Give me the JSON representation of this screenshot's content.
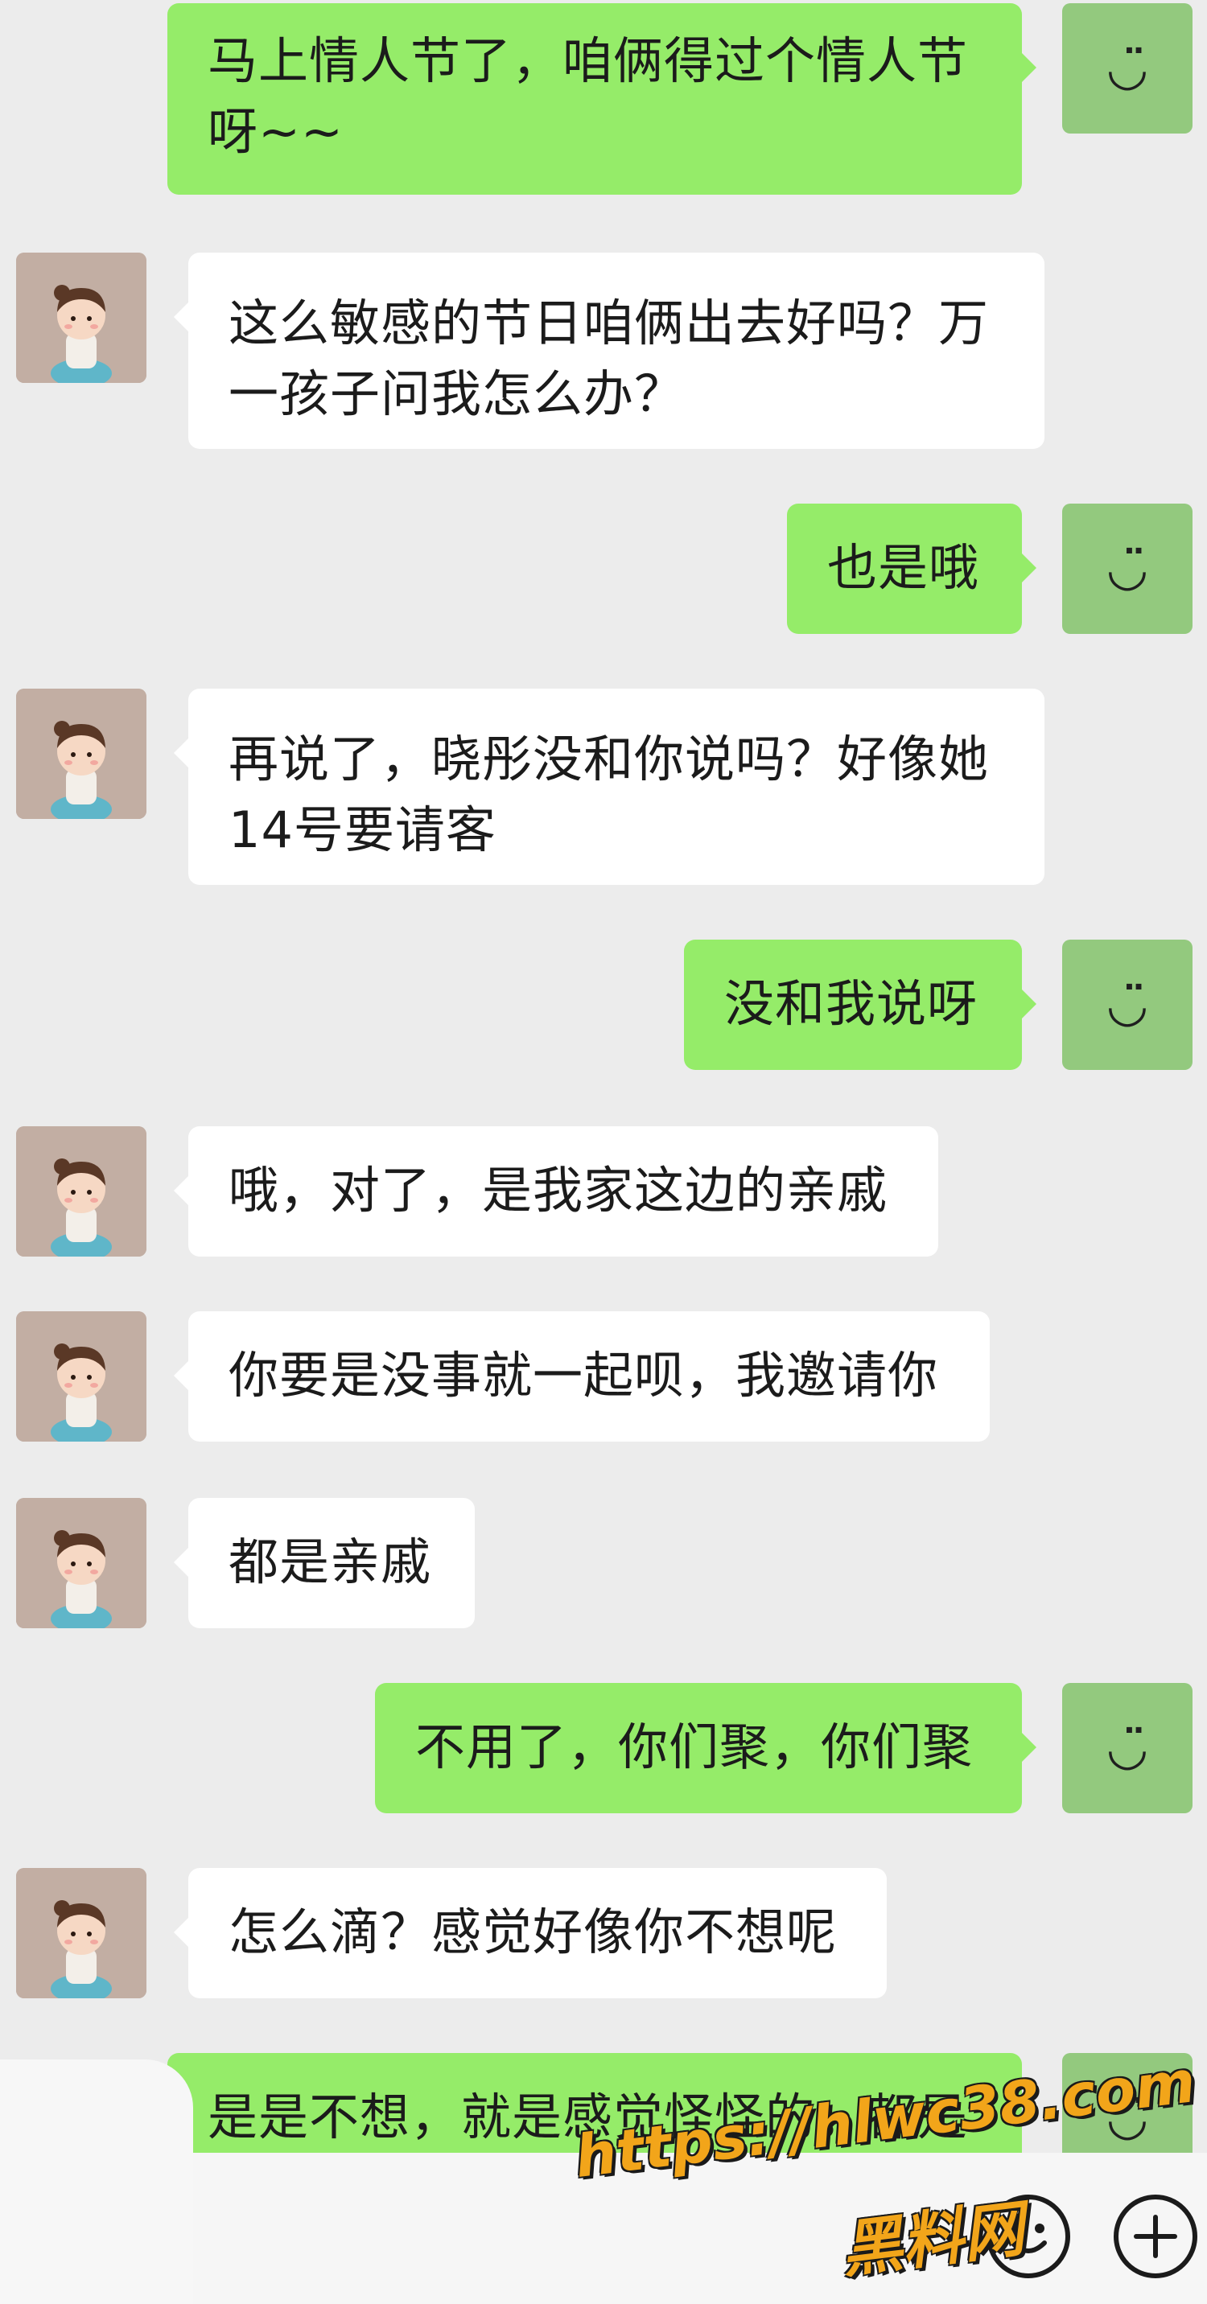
{
  "messages": [
    {
      "side": "me",
      "lines": [
        "马上情人节了，咱俩得过个情人节",
        "呀~~"
      ]
    },
    {
      "side": "her",
      "lines": [
        "这么敏感的节日咱俩出去好吗？万",
        "一孩子问我怎么办？"
      ]
    },
    {
      "side": "me",
      "lines": [
        "也是哦"
      ]
    },
    {
      "side": "her",
      "lines": [
        "再说了，晓彤没和你说吗？好像她",
        "14号要请客"
      ]
    },
    {
      "side": "me",
      "lines": [
        "没和我说呀"
      ]
    },
    {
      "side": "her",
      "lines": [
        "哦，对了，是我家这边的亲戚"
      ]
    },
    {
      "side": "her",
      "lines": [
        "你要是没事就一起呗，我邀请你"
      ]
    },
    {
      "side": "her",
      "lines": [
        "都是亲戚"
      ]
    },
    {
      "side": "me",
      "lines": [
        "不用了，你们聚，你们聚"
      ]
    },
    {
      "side": "her",
      "lines": [
        "怎么滴？感觉好像你不想呢"
      ]
    },
    {
      "side": "me",
      "lines": [
        "是是不想，就是感觉怪怪的。都是"
      ]
    }
  ],
  "my_avatar_glyph": "◡̈",
  "watermark": {
    "url": "https://hlwc38.com",
    "name": "黑料网"
  },
  "icons": {
    "emoji": "smiley-icon",
    "more": "plus-icon"
  },
  "colors": {
    "my_bubble": "#95ec69",
    "her_bubble": "#ffffff",
    "background": "#ececec"
  }
}
